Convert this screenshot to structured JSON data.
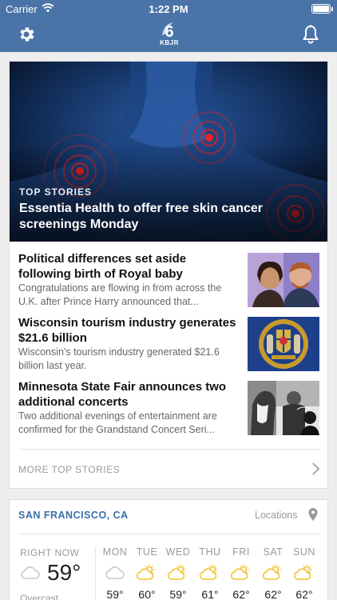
{
  "status_bar": {
    "carrier": "Carrier",
    "time": "1:22 PM"
  },
  "nav": {
    "logo_text": "KBJR",
    "logo_number": "6",
    "settings_icon": "gear-icon",
    "notifications_icon": "bell-icon"
  },
  "hero": {
    "eyebrow": "TOP STORIES",
    "headline": "Essentia Health to offer free skin cancer screenings Monday"
  },
  "stories": [
    {
      "title": "Political differences set aside following birth of Royal baby",
      "summary": "Congratulations are flowing in from across the U.K. after Prince Harry announced that..."
    },
    {
      "title": "Wisconsin tourism industry generates $21.6 billion",
      "summary": "Wisconsin's tourism industry generated $21.6 billion last year."
    },
    {
      "title": "Minnesota State Fair announces two additional concerts",
      "summary": "Two additional evenings of entertainment are confirmed for the Grandstand Concert Seri..."
    }
  ],
  "more_label": "MORE TOP STORIES",
  "weather": {
    "city": "SAN FRANCISCO, CA",
    "locations_label": "Locations",
    "now_label": "RIGHT NOW",
    "now_temp": "59°",
    "now_condition": "Overcast",
    "days": [
      {
        "name": "MON",
        "icon": "cloud-icon",
        "high": "59°"
      },
      {
        "name": "TUE",
        "icon": "partly-sunny-icon",
        "high": "60°"
      },
      {
        "name": "WED",
        "icon": "partly-sunny-icon",
        "high": "59°"
      },
      {
        "name": "THU",
        "icon": "partly-sunny-icon",
        "high": "61°"
      },
      {
        "name": "FRI",
        "icon": "partly-sunny-icon",
        "high": "62°"
      },
      {
        "name": "SAT",
        "icon": "partly-sunny-icon",
        "high": "62°"
      },
      {
        "name": "SUN",
        "icon": "partly-sunny-icon",
        "high": "62°"
      }
    ]
  },
  "colors": {
    "nav": "#4a74a8",
    "accent": "#3b6ea8",
    "sun": "#f2c230"
  }
}
